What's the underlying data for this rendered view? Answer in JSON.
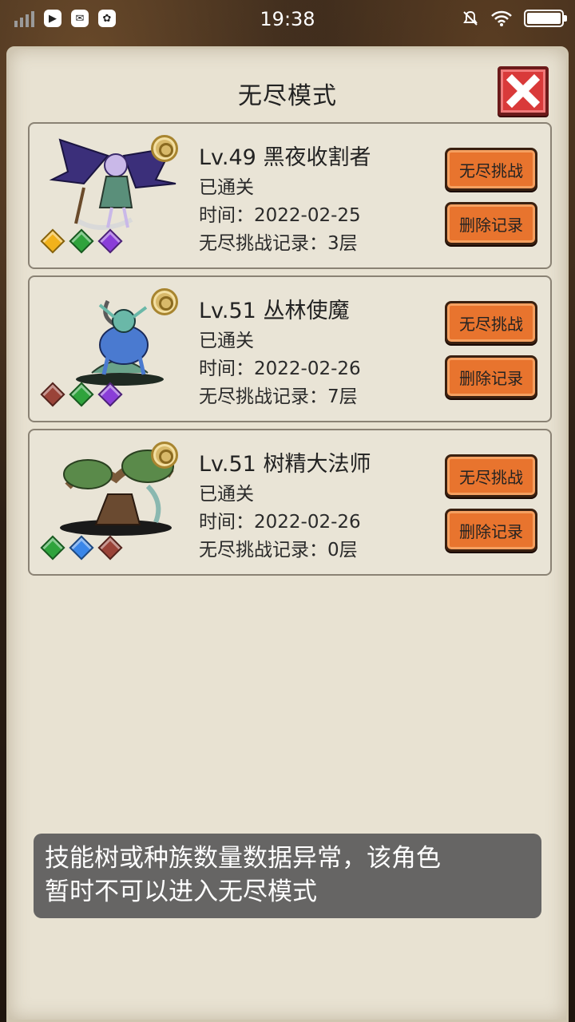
{
  "status_bar": {
    "time": "19:38"
  },
  "panel": {
    "title": "无尽模式"
  },
  "records": [
    {
      "name": "Lv.49 黑夜收割者",
      "status": "已通关",
      "time": "时间：2022-02-25",
      "endless_record": "无尽挑战记录：3层",
      "challenge_label": "无尽挑战",
      "delete_label": "删除记录",
      "gems": [
        "#f2b21b",
        "#2fa33c",
        "#8a3ed8"
      ]
    },
    {
      "name": "Lv.51 丛林使魔",
      "status": "已通关",
      "time": "时间：2022-02-26",
      "endless_record": "无尽挑战记录：7层",
      "challenge_label": "无尽挑战",
      "delete_label": "删除记录",
      "gems": [
        "#9a4338",
        "#2fa33c",
        "#8a3ed8"
      ]
    },
    {
      "name": "Lv.51 树精大法师",
      "status": "已通关",
      "time": "时间：2022-02-26",
      "endless_record": "无尽挑战记录：0层",
      "challenge_label": "无尽挑战",
      "delete_label": "删除记录",
      "gems": [
        "#2fa33c",
        "#3a86e8",
        "#9a4338"
      ]
    }
  ],
  "toast": {
    "line1": "技能树或种族数量数据异常，该角色",
    "line2": "暂时不可以进入无尽模式"
  },
  "colors": {
    "button": "#e8742e",
    "close": "#d93a3a",
    "parchment": "#e8e2d2"
  }
}
